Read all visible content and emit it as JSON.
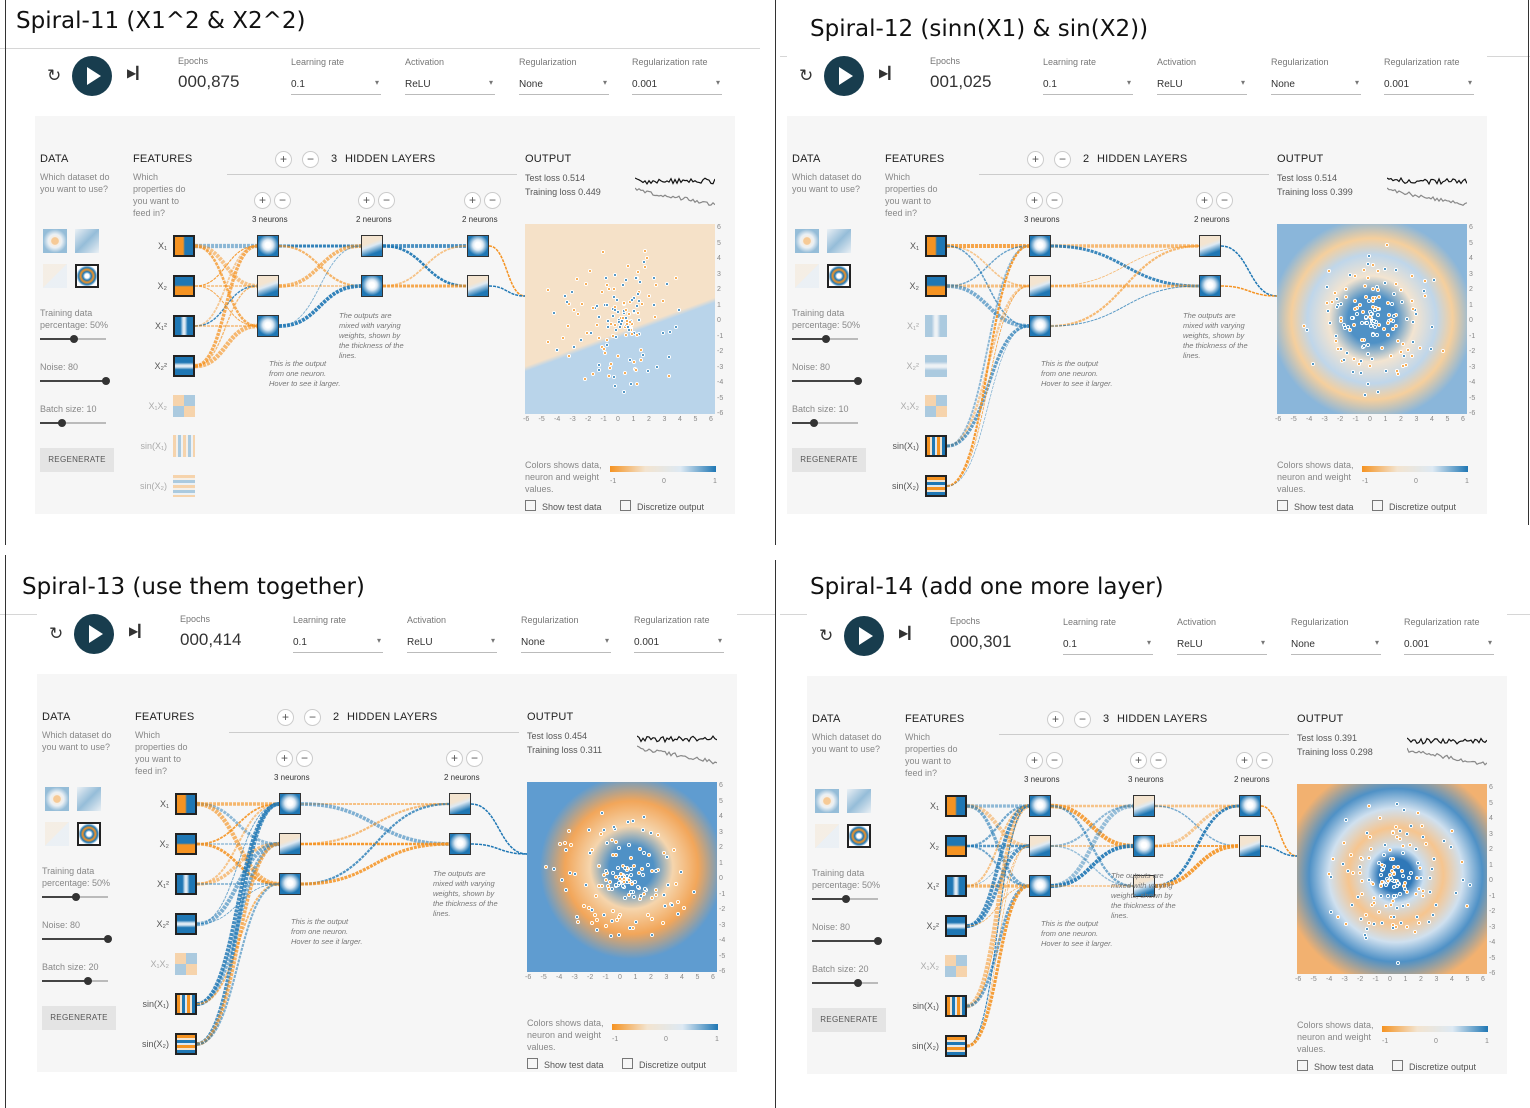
{
  "panels": [
    {
      "title": "Spiral-11 (X1^2 & X2^2)",
      "epochs_label": "Epochs",
      "epochs": "000,875",
      "learning_rate_label": "Learning rate",
      "learning_rate": "0.1",
      "activation_label": "Activation",
      "activation": "ReLU",
      "regularization_label": "Regularization",
      "regularization": "None",
      "regularization_rate_label": "Regularization rate",
      "regularization_rate": "0.001",
      "data_label": "DATA",
      "data_desc": "Which dataset do you want to use?",
      "features_label": "FEATURES",
      "features_desc": "Which properties do you want to feed in?",
      "hidden_layers_count": "3",
      "hidden_layers_label": "HIDDEN LAYERS",
      "layers": [
        "3 neurons",
        "2 neurons",
        "2 neurons"
      ],
      "output_label": "OUTPUT",
      "test_loss": "Test loss 0.514",
      "training_loss": "Training loss 0.449",
      "training_pct": "Training data percentage:  50%",
      "noise": "Noise:  80",
      "batch": "Batch size:  10",
      "regenerate": "REGENERATE",
      "features": [
        {
          "label": "X₁",
          "active": true
        },
        {
          "label": "X₂",
          "active": true
        },
        {
          "label": "X₁²",
          "active": true
        },
        {
          "label": "X₂²",
          "active": true
        },
        {
          "label": "X₁X₂",
          "active": false
        },
        {
          "label": "sin(X₁)",
          "active": false
        },
        {
          "label": "sin(X₂)",
          "active": false
        }
      ],
      "legend_text": "Colors shows data, neuron and weight values.",
      "legend_ticks": [
        "-1",
        "0",
        "1"
      ],
      "axis_ticks": [
        "-6",
        "-5",
        "-4",
        "-3",
        "-2",
        "-1",
        "0",
        "1",
        "2",
        "3",
        "4",
        "5",
        "6"
      ],
      "note_output": "This is the output from one neuron. Hover to see it larger.",
      "note_weights": "The outputs are mixed with varying weights, shown by the thickness of the lines.",
      "show_test": "Show test data",
      "discretize": "Discretize output"
    },
    {
      "title": "Spiral-12 (sinn(X1) & sin(X2))",
      "epochs_label": "Epochs",
      "epochs": "001,025",
      "learning_rate_label": "Learning rate",
      "learning_rate": "0.1",
      "activation_label": "Activation",
      "activation": "ReLU",
      "regularization_label": "Regularization",
      "regularization": "None",
      "regularization_rate_label": "Regularization rate",
      "regularization_rate": "0.001",
      "data_label": "DATA",
      "data_desc": "Which dataset do you want to use?",
      "features_label": "FEATURES",
      "features_desc": "Which properties do you want to feed in?",
      "hidden_layers_count": "2",
      "hidden_layers_label": "HIDDEN LAYERS",
      "layers": [
        "3 neurons",
        "2 neurons"
      ],
      "output_label": "OUTPUT",
      "test_loss": "Test loss 0.514",
      "training_loss": "Training loss 0.399",
      "training_pct": "Training data percentage:  50%",
      "noise": "Noise:  80",
      "batch": "Batch size:  10",
      "regenerate": "REGENERATE",
      "features": [
        {
          "label": "X₁",
          "active": true
        },
        {
          "label": "X₂",
          "active": true
        },
        {
          "label": "X₁²",
          "active": false
        },
        {
          "label": "X₂²",
          "active": false
        },
        {
          "label": "X₁X₂",
          "active": false
        },
        {
          "label": "sin(X₁)",
          "active": true
        },
        {
          "label": "sin(X₂)",
          "active": true
        }
      ],
      "legend_text": "Colors shows data, neuron and weight values.",
      "legend_ticks": [
        "-1",
        "0",
        "1"
      ],
      "axis_ticks": [
        "-6",
        "-5",
        "-4",
        "-3",
        "-2",
        "-1",
        "0",
        "1",
        "2",
        "3",
        "4",
        "5",
        "6"
      ],
      "note_output": "This is the output from one neuron. Hover to see it larger.",
      "note_weights": "The outputs are mixed with varying weights, shown by the thickness of the lines.",
      "show_test": "Show test data",
      "discretize": "Discretize output"
    },
    {
      "title": "Spiral-13 (use them together)",
      "epochs_label": "Epochs",
      "epochs": "000,414",
      "learning_rate_label": "Learning rate",
      "learning_rate": "0.1",
      "activation_label": "Activation",
      "activation": "ReLU",
      "regularization_label": "Regularization",
      "regularization": "None",
      "regularization_rate_label": "Regularization rate",
      "regularization_rate": "0.001",
      "data_label": "DATA",
      "data_desc": "Which dataset do you want to use?",
      "features_label": "FEATURES",
      "features_desc": "Which properties do you want to feed in?",
      "hidden_layers_count": "2",
      "hidden_layers_label": "HIDDEN LAYERS",
      "layers": [
        "3 neurons",
        "2 neurons"
      ],
      "output_label": "OUTPUT",
      "test_loss": "Test loss 0.454",
      "training_loss": "Training loss 0.311",
      "training_pct": "Training data percentage:  50%",
      "noise": "Noise:  80",
      "batch": "Batch size:  20",
      "regenerate": "REGENERATE",
      "features": [
        {
          "label": "X₁",
          "active": true
        },
        {
          "label": "X₂",
          "active": true
        },
        {
          "label": "X₁²",
          "active": true
        },
        {
          "label": "X₂²",
          "active": true
        },
        {
          "label": "X₁X₂",
          "active": false
        },
        {
          "label": "sin(X₁)",
          "active": true
        },
        {
          "label": "sin(X₂)",
          "active": true
        }
      ],
      "legend_text": "Colors shows data, neuron and weight values.",
      "legend_ticks": [
        "-1",
        "0",
        "1"
      ],
      "axis_ticks": [
        "-6",
        "-5",
        "-4",
        "-3",
        "-2",
        "-1",
        "0",
        "1",
        "2",
        "3",
        "4",
        "5",
        "6"
      ],
      "note_output": "This is the output from one neuron. Hover to see it larger.",
      "note_weights": "The outputs are mixed with varying weights, shown by the thickness of the lines.",
      "show_test": "Show test data",
      "discretize": "Discretize output"
    },
    {
      "title": "Spiral-14 (add one more layer)",
      "epochs_label": "Epochs",
      "epochs": "000,301",
      "learning_rate_label": "Learning rate",
      "learning_rate": "0.1",
      "activation_label": "Activation",
      "activation": "ReLU",
      "regularization_label": "Regularization",
      "regularization": "None",
      "regularization_rate_label": "Regularization rate",
      "regularization_rate": "0.001",
      "data_label": "DATA",
      "data_desc": "Which dataset do you want to use?",
      "features_label": "FEATURES",
      "features_desc": "Which properties do you want to feed in?",
      "hidden_layers_count": "3",
      "hidden_layers_label": "HIDDEN LAYERS",
      "layers": [
        "3 neurons",
        "3 neurons",
        "2 neurons"
      ],
      "output_label": "OUTPUT",
      "test_loss": "Test loss 0.391",
      "training_loss": "Training loss 0.298",
      "training_pct": "Training data percentage:  50%",
      "noise": "Noise:  80",
      "batch": "Batch size:  20",
      "regenerate": "REGENERATE",
      "features": [
        {
          "label": "X₁",
          "active": true
        },
        {
          "label": "X₂",
          "active": true
        },
        {
          "label": "X₁²",
          "active": true
        },
        {
          "label": "X₂²",
          "active": true
        },
        {
          "label": "X₁X₂",
          "active": false
        },
        {
          "label": "sin(X₁)",
          "active": true
        },
        {
          "label": "sin(X₂)",
          "active": true
        }
      ],
      "legend_text": "Colors shows data, neuron and weight values.",
      "legend_ticks": [
        "-1",
        "0",
        "1"
      ],
      "axis_ticks": [
        "-6",
        "-5",
        "-4",
        "-3",
        "-2",
        "-1",
        "0",
        "1",
        "2",
        "3",
        "4",
        "5",
        "6"
      ],
      "note_output": "This is the output from one neuron. Hover to see it larger.",
      "note_weights": "The outputs are mixed with varying weights, shown by the thickness of the lines.",
      "show_test": "Show test data",
      "discretize": "Discretize output"
    }
  ],
  "colors": {
    "orange": "#f59322",
    "blue": "#1f77b4",
    "dark": "#183d4e"
  }
}
